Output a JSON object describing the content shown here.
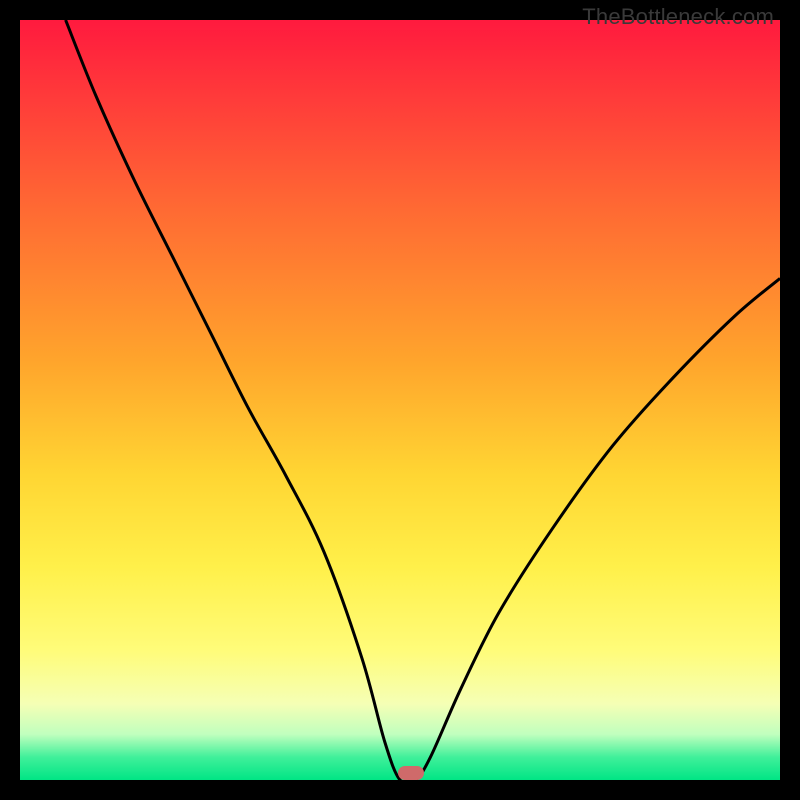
{
  "watermark": "TheBottleneck.com",
  "gradient": {
    "top": "#ff1a3e",
    "bottom": "#00e585"
  },
  "curve_stroke": "#000000",
  "curve_stroke_width": 3,
  "marker": {
    "x_pct": 51.5,
    "y_pct": 99.1,
    "fill": "#cf6a6a"
  },
  "chart_data": {
    "type": "line",
    "title": "",
    "xlabel": "",
    "ylabel": "",
    "xlim": [
      0,
      100
    ],
    "ylim": [
      0,
      100
    ],
    "series": [
      {
        "name": "bottleneck-curve",
        "x": [
          6,
          10,
          15,
          20,
          25,
          30,
          35,
          40,
          45,
          48,
          50,
          52,
          54,
          58,
          63,
          70,
          78,
          86,
          94,
          100
        ],
        "y": [
          100,
          90,
          79,
          69,
          59,
          49,
          40,
          30,
          16,
          5,
          0,
          0,
          3,
          12,
          22,
          33,
          44,
          53,
          61,
          66
        ]
      }
    ],
    "marker_point": {
      "x": 51.5,
      "y": 0.9
    },
    "heat_bands": [
      {
        "y": 100,
        "color": "#ff1a3e"
      },
      {
        "y": 50,
        "color": "#ffd633"
      },
      {
        "y": 5,
        "color": "#f5ffb5"
      },
      {
        "y": 0,
        "color": "#00e585"
      }
    ]
  }
}
